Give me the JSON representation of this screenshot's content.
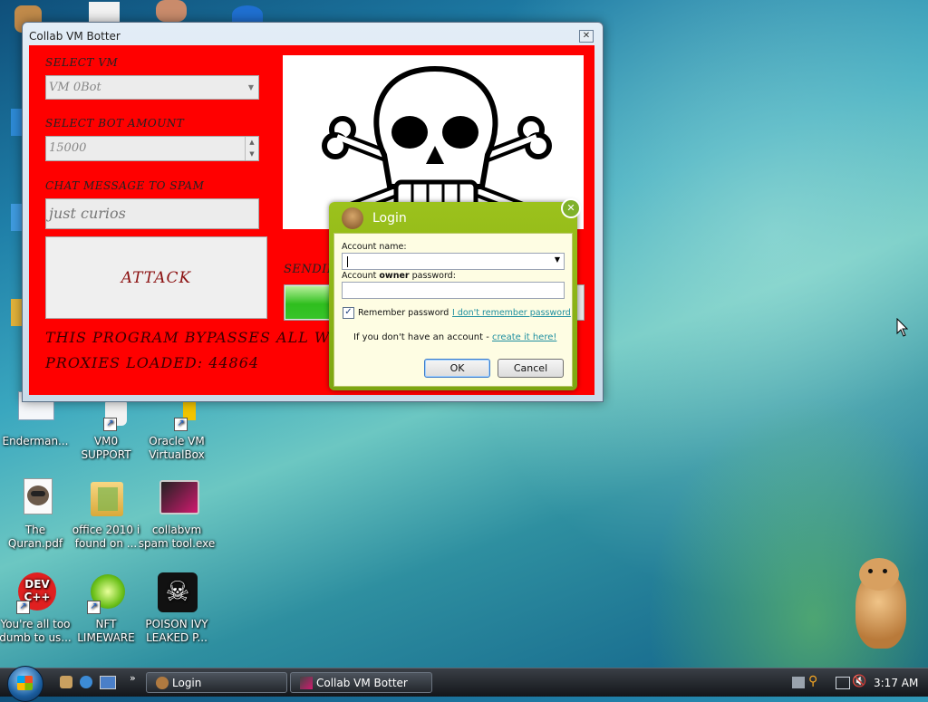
{
  "desktop": {
    "icons": [
      {
        "id": "enderman",
        "label": "Enderman...",
        "icon": "document-icon"
      },
      {
        "id": "vm0",
        "label": "VM0\nSUPPORT",
        "icon": "doctor-icon"
      },
      {
        "id": "vbox",
        "label": "Oracle VM\nVirtualBox",
        "icon": "virtualbox-icon"
      },
      {
        "id": "quran",
        "label": "The\nQuran.pdf",
        "icon": "raccoon-icon"
      },
      {
        "id": "office",
        "label": "office 2010 i\nfound on ...",
        "icon": "folder-icon"
      },
      {
        "id": "collabvm",
        "label": "collabvm\nspam tool.exe",
        "icon": "monitor-icon"
      },
      {
        "id": "dev",
        "label": "You're all too\ndumb to us...",
        "icon": "devcpp-icon"
      },
      {
        "id": "nft",
        "label": "NFT\nLIMEWARE",
        "icon": "lime-icon"
      },
      {
        "id": "poison",
        "label": "POISON IVY\nLEAKED P...",
        "icon": "skull-icon"
      }
    ]
  },
  "botter": {
    "title": "Collab VM Botter",
    "select_vm_label": "SELECT VM",
    "select_vm_value": "VM 0Bot",
    "bot_amount_label": "SELECT BOT AMOUNT",
    "bot_amount_value": "15000",
    "chat_label": "CHAT MESSAGE TO SPAM",
    "chat_value": "just curios",
    "attack_label": "ATTACK",
    "sending_label": "SENDIN",
    "bypass_text": "THIS PROGRAM BYPASSES ALL WHIT",
    "proxies_text": "PROXIES LOADED: 44864",
    "progress": 0.2
  },
  "login": {
    "title": "Login",
    "account_name_label": "Account name:",
    "password_label_pre": "Account ",
    "password_label_bold": "owner",
    "password_label_post": " password:",
    "remember_label": "Remember password",
    "remember_checked": true,
    "forgot_link": "I don't remember password",
    "no_account_text": "If you don't have an account - ",
    "create_link": "create it here!",
    "ok_label": "OK",
    "cancel_label": "Cancel"
  },
  "taskbar": {
    "buttons": [
      {
        "label": "Login"
      },
      {
        "label": "Collab VM Botter"
      }
    ],
    "clock": "3:17 AM",
    "colors": {
      "accent": "#ff0000",
      "login_green": "#8db81a"
    }
  }
}
